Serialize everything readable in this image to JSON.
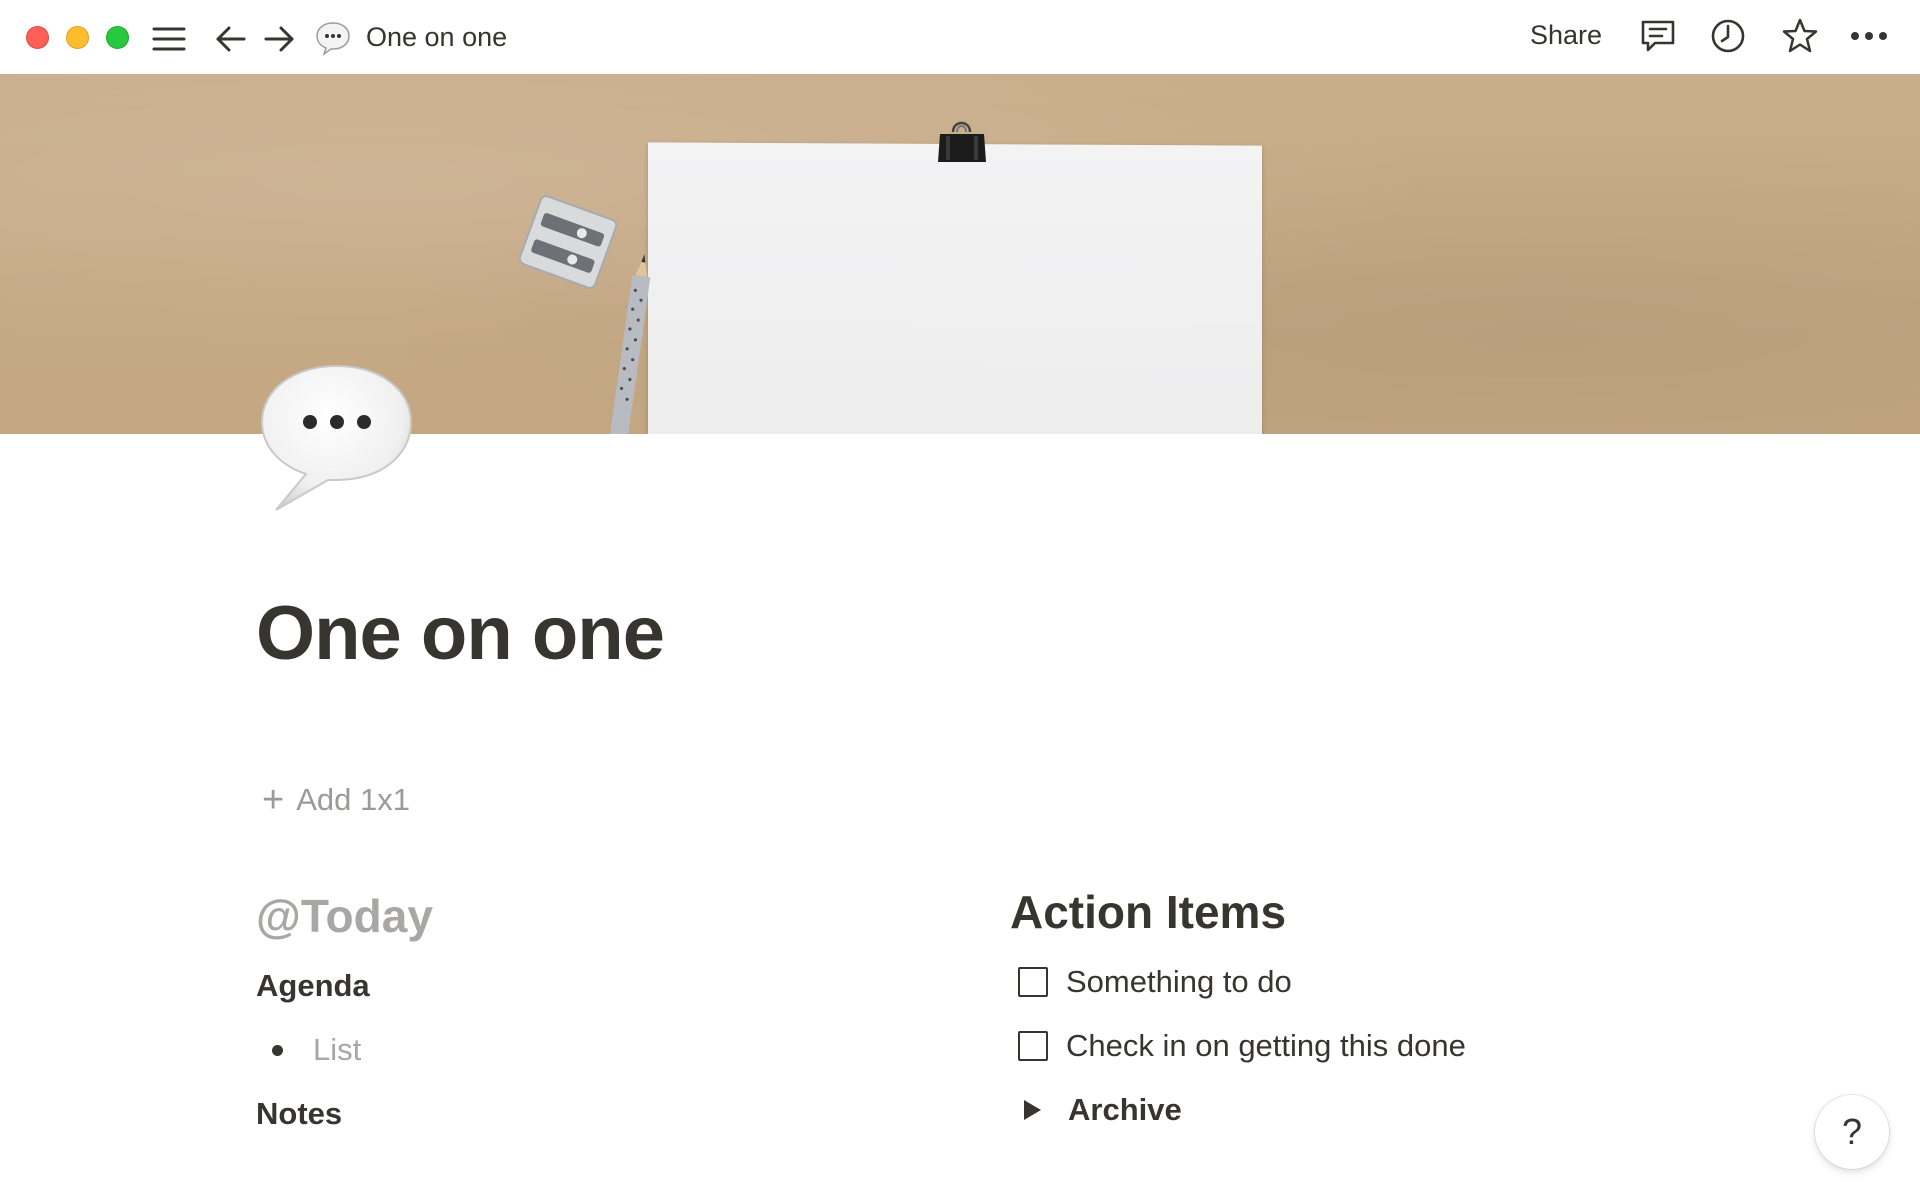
{
  "window": {
    "traffic_lights": [
      "close",
      "minimize",
      "zoom"
    ],
    "colors": {
      "close": "#fe5f57",
      "minimize": "#febc2e",
      "zoom": "#28c840"
    }
  },
  "topbar": {
    "icons": [
      "sidebar-menu-icon",
      "back-arrow-icon",
      "forward-arrow-icon",
      "speech-bubble-icon"
    ],
    "breadcrumb_title": "One on one",
    "share_label": "Share",
    "right_icons": [
      "comments-icon",
      "history-clock-icon",
      "favorite-star-icon",
      "more-dots-icon"
    ]
  },
  "cover": {
    "description_icon": "kraft-paper-cover"
  },
  "page": {
    "icon": "speech-bubble-icon",
    "title": "One on one",
    "add_button_label": "Add 1x1"
  },
  "left_column": {
    "date_mention": "@Today",
    "agenda_heading": "Agenda",
    "agenda_list_placeholder": "List",
    "notes_heading": "Notes"
  },
  "right_column": {
    "heading": "Action Items",
    "todos": [
      {
        "label": "Something to do",
        "checked": false
      },
      {
        "label": "Check in on getting this done",
        "checked": false
      }
    ],
    "toggle_label": "Archive"
  },
  "help_button_label": "?"
}
